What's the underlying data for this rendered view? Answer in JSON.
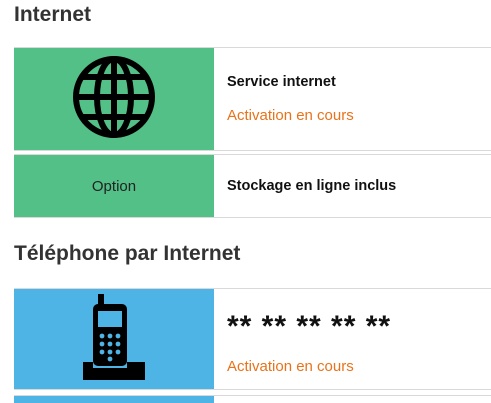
{
  "sections": {
    "internet": {
      "title": "Internet",
      "service": {
        "icon": "globe-icon",
        "title": "Service internet",
        "status": "Activation en cours",
        "tile_color": "#52c087"
      },
      "option": {
        "label": "Option",
        "title": "Stockage en ligne inclus",
        "tile_color": "#52c087"
      }
    },
    "phone": {
      "title": "Téléphone par Internet",
      "line": {
        "icon": "cordless-phone-icon",
        "number": "** ** ** ** **",
        "status": "Activation en cours",
        "tile_color": "#4db4e5"
      }
    }
  },
  "colors": {
    "status": "#e8731a",
    "internet_tile": "#52c087",
    "phone_tile": "#4db4e5"
  }
}
